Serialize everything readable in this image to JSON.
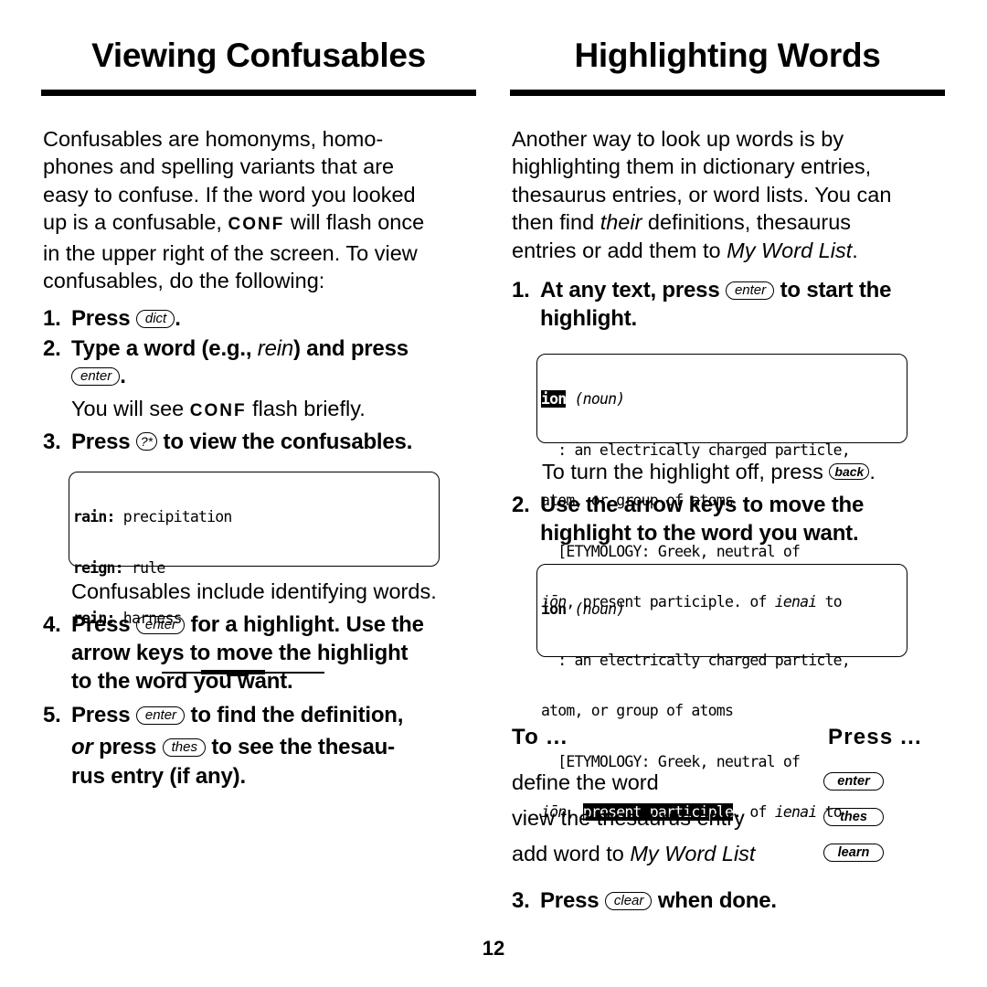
{
  "left": {
    "title": "Viewing Confusables",
    "intro": {
      "part1": "Confusables are homonyms, homo-",
      "part2": "phones and spelling variants that are",
      "part3": "easy to confuse. If the word you looked",
      "part4a": "up is a confusable, ",
      "conf": "CONF",
      "part4b": " will flash once",
      "part5": "in the upper right of the screen. To view",
      "part6": "confusables, do the following:"
    },
    "steps": {
      "s1": {
        "num": "1.",
        "text": "Press ",
        "key": "dict",
        "end": "."
      },
      "s2": {
        "num": "2.",
        "text_a": "Type a word (e.g., ",
        "italic": "rein",
        "text_b": ") and press",
        "key": "enter",
        "end": "."
      },
      "s2_note": {
        "a": "You will see ",
        "conf": "CONF",
        "b": " flash briefly."
      },
      "s3": {
        "num": "3.",
        "text": "Press ",
        "key": "?*",
        "end": " to view the confusables."
      },
      "screen_note": "Confusables include identifying words.",
      "s4": {
        "num": "4.",
        "text": "Press ",
        "key": "enter",
        "line1_end": " for a highlight. Use the",
        "line2": "arrow keys to move the highlight",
        "line3": "to the word you want."
      },
      "s5": {
        "num": "5.",
        "text": "Press ",
        "key": "enter",
        "line1_end": " to find the definition,",
        "or": "or",
        "press": " press ",
        "key2": "thes",
        "line2_end": " to see the thesau-",
        "line3": "rus entry (if any)."
      }
    },
    "confusables_screen": {
      "rows": [
        {
          "word": "rain:",
          "meaning": " precipitation"
        },
        {
          "word": "reign:",
          "meaning": " rule"
        },
        {
          "word": "rein:",
          "meaning": " harness"
        }
      ]
    }
  },
  "right": {
    "title": "Highlighting Words",
    "intro": {
      "l1": "Another way to look up words is by",
      "l2": "highlighting them in dictionary entries,",
      "l3": "thesaurus entries, or word lists. You can",
      "l4a": "then find ",
      "l4i": "their",
      "l4b": " definitions, thesaurus",
      "l5a": "entries or add them to ",
      "l5i": "My Word List",
      "l5b": "."
    },
    "steps": {
      "s1": {
        "num": "1.",
        "text": "At any text, press ",
        "key": "enter",
        "end": " to start the",
        "line2": "highlight."
      },
      "off_note": {
        "text": "To turn the highlight off, press ",
        "key": "back",
        "end": "."
      },
      "s2": {
        "num": "2.",
        "line1": "Use the arrow keys to move the",
        "line2": "highlight to the word you want."
      },
      "s3": {
        "num": "3.",
        "text": "Press ",
        "key": "clear",
        "end": " when done."
      }
    },
    "screen1": {
      "headword": "ion",
      "pos": "(noun)",
      "line2": "  : an electrically charged particle,",
      "line3": "atom, or group of atoms",
      "line4": "  [ETYMOLOGY: Greek, neutral of",
      "line5_i1": "iōn",
      "line5_a": ", present participle. of ",
      "line5_i2": "ienai",
      "line5_b": " to"
    },
    "screen2": {
      "headword": "ion",
      "pos": "(noun)",
      "line2": "  : an electrically charged particle,",
      "line3": "atom, or group of atoms",
      "line4": "  [ETYMOLOGY: Greek, neutral of",
      "line5_i1": "iōn",
      "line5_sep": ", ",
      "line5_hl": "present participle",
      "line5_a": ". of ",
      "line5_i2": "ienai",
      "line5_b": " to"
    },
    "table": {
      "col1": "To ...",
      "col2": "Press ...",
      "rows": [
        {
          "action": "define the word",
          "key": "enter"
        },
        {
          "action": "view the thesaurus entry",
          "key": "thes"
        },
        {
          "action_a": "add word to ",
          "action_i": "My Word List",
          "key": "learn"
        }
      ]
    }
  },
  "page_number": "12"
}
